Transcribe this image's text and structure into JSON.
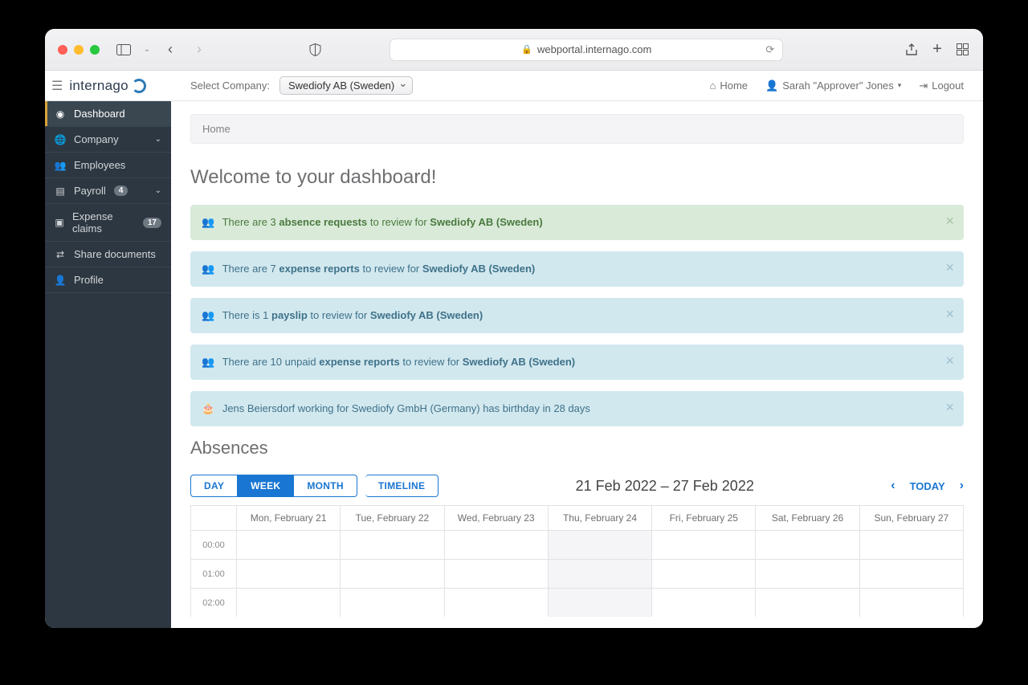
{
  "browser": {
    "url": "webportal.internago.com"
  },
  "logo_text": "internago",
  "sidebar": {
    "items": [
      {
        "label": "Dashboard"
      },
      {
        "label": "Company"
      },
      {
        "label": "Employees"
      },
      {
        "label": "Payroll",
        "badge": "4"
      },
      {
        "label": "Expense claims",
        "badge": "17"
      },
      {
        "label": "Share documents"
      },
      {
        "label": "Profile"
      }
    ]
  },
  "topbar": {
    "select_label": "Select Company:",
    "company": "Swediofy AB (Sweden)",
    "home_label": "Home",
    "user_label": "Sarah \"Approver\" Jones",
    "logout_label": "Logout"
  },
  "breadcrumb": "Home",
  "page_title": "Welcome to your dashboard!",
  "alerts": [
    {
      "style": "green",
      "pre": "There are 3 ",
      "b1": "absence requests",
      "mid": " to review for ",
      "b2": "Swediofy AB (Sweden)"
    },
    {
      "style": "blue",
      "pre": "There are 7 ",
      "b1": "expense reports",
      "mid": " to review for ",
      "b2": "Swediofy AB (Sweden)"
    },
    {
      "style": "blue",
      "pre": "There is 1 ",
      "b1": "payslip",
      "mid": " to review for ",
      "b2": "Swediofy AB (Sweden)"
    },
    {
      "style": "blue",
      "pre": "There are 10 unpaid ",
      "b1": "expense reports",
      "mid": " to review for ",
      "b2": "Swediofy AB (Sweden)"
    },
    {
      "style": "blue",
      "text": "Jens Beiersdorf working for Swediofy GmbH (Germany) has birthday in 28 days"
    }
  ],
  "absences_title": "Absences",
  "calendar": {
    "views": {
      "day": "DAY",
      "week": "WEEK",
      "month": "MONTH",
      "timeline": "TIMELINE"
    },
    "range": "21 Feb 2022 – 27 Feb 2022",
    "today_label": "TODAY",
    "days": [
      "Mon, February 21",
      "Tue, February 22",
      "Wed, February 23",
      "Thu, February 24",
      "Fri, February 25",
      "Sat, February 26",
      "Sun, February 27"
    ],
    "times": [
      "00:00",
      "01:00",
      "02:00"
    ]
  }
}
